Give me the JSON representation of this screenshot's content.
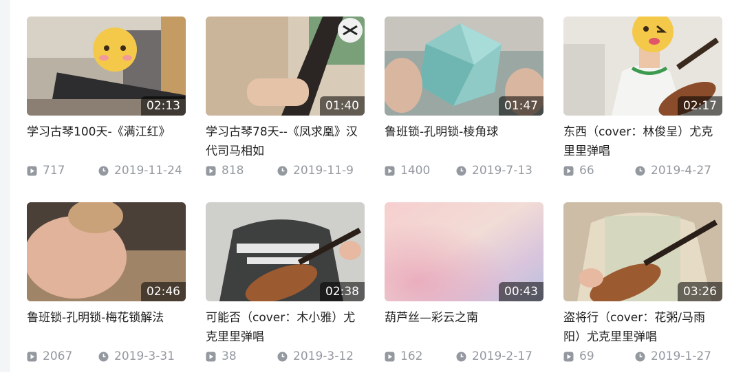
{
  "colors": {
    "title_text": "#222222",
    "meta_text": "#9499a0",
    "duration_bg": "rgba(0,0,0,0.55)",
    "icon": "#9499a0"
  },
  "icons": {
    "plays": "play-square-icon",
    "date": "clock-icon"
  },
  "videos": [
    {
      "title": "学习古琴100天-《满江红》",
      "duration": "02:13",
      "plays": "717",
      "date": "2019-11-24"
    },
    {
      "title": "学习古琴78天--《凤求凰》汉代司马相如",
      "duration": "01:40",
      "plays": "818",
      "date": "2019-11-9"
    },
    {
      "title": "鲁班锁-孔明锁-棱角球",
      "duration": "01:47",
      "plays": "1400",
      "date": "2019-7-13"
    },
    {
      "title": "东西（cover：林俊呈）尤克里里弹唱",
      "duration": "02:17",
      "plays": "66",
      "date": "2019-4-27"
    },
    {
      "title": "鲁班锁-孔明锁-梅花锁解法",
      "duration": "02:46",
      "plays": "2067",
      "date": "2019-3-31"
    },
    {
      "title": "可能否（cover：木小雅）尤克里里弹唱",
      "duration": "02:38",
      "plays": "38",
      "date": "2019-3-12"
    },
    {
      "title": "葫芦丝—彩云之南",
      "duration": "00:43",
      "plays": "162",
      "date": "2019-2-17"
    },
    {
      "title": "盗将行（cover：花粥/马雨阳）尤克里里弹唱",
      "duration": "03:26",
      "plays": "69",
      "date": "2019-1-27"
    }
  ]
}
